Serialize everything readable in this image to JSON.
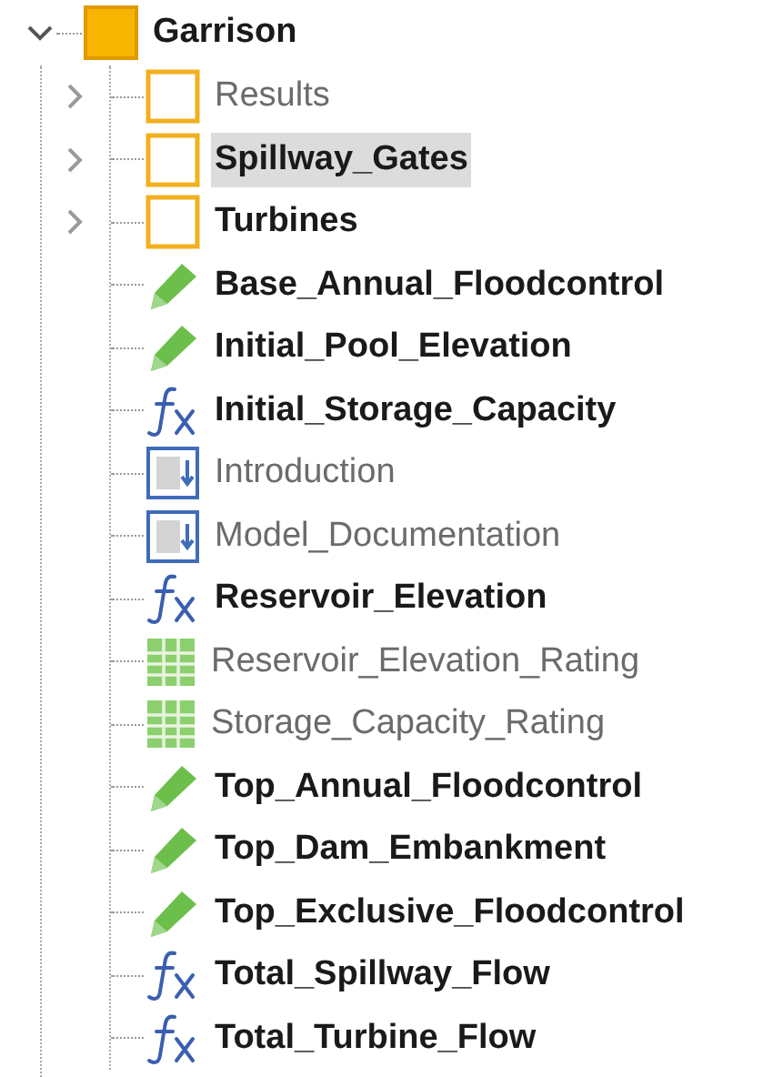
{
  "tree": {
    "label": "Garrison",
    "kind": "root",
    "expanded": true,
    "bold": true,
    "selected": false,
    "children": [
      {
        "label": "Results",
        "kind": "folder",
        "expanded": false,
        "bold": false,
        "selected": false
      },
      {
        "label": "Spillway_Gates",
        "kind": "folder",
        "expanded": false,
        "bold": true,
        "selected": true
      },
      {
        "label": "Turbines",
        "kind": "folder",
        "expanded": false,
        "bold": true,
        "selected": false
      },
      {
        "label": "Base_Annual_Floodcontrol",
        "kind": "input",
        "bold": true,
        "selected": false
      },
      {
        "label": "Initial_Pool_Elevation",
        "kind": "input",
        "bold": true,
        "selected": false
      },
      {
        "label": "Initial_Storage_Capacity",
        "kind": "function",
        "bold": true,
        "selected": false
      },
      {
        "label": "Introduction",
        "kind": "document",
        "bold": false,
        "selected": false
      },
      {
        "label": "Model_Documentation",
        "kind": "document",
        "bold": false,
        "selected": false
      },
      {
        "label": "Reservoir_Elevation",
        "kind": "function",
        "bold": true,
        "selected": false
      },
      {
        "label": "Reservoir_Elevation_Rating",
        "kind": "table",
        "bold": false,
        "selected": false
      },
      {
        "label": "Storage_Capacity_Rating",
        "kind": "table",
        "bold": false,
        "selected": false
      },
      {
        "label": "Top_Annual_Floodcontrol",
        "kind": "input",
        "bold": true,
        "selected": false
      },
      {
        "label": "Top_Dam_Embankment",
        "kind": "input",
        "bold": true,
        "selected": false
      },
      {
        "label": "Top_Exclusive_Floodcontrol",
        "kind": "input",
        "bold": true,
        "selected": false
      },
      {
        "label": "Total_Spillway_Flow",
        "kind": "function",
        "bold": true,
        "selected": false
      },
      {
        "label": "Total_Turbine_Flow",
        "kind": "function",
        "bold": true,
        "selected": false
      }
    ]
  }
}
